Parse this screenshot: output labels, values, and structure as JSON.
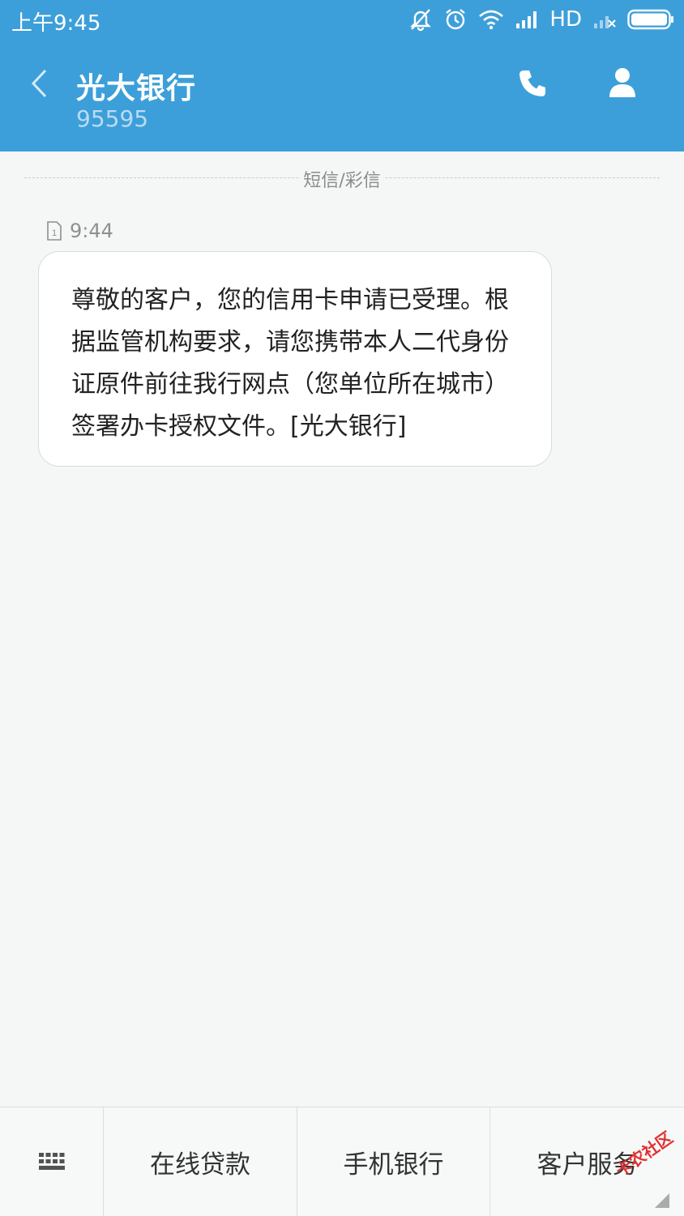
{
  "status_bar": {
    "time": "上午9:45",
    "network": "HD"
  },
  "header": {
    "title": "光大银行",
    "subtitle": "95595"
  },
  "divider_label": "短信/彩信",
  "message": {
    "time": "9:44",
    "body": "尊敬的客户，您的信用卡申请已受理。根据监管机构要求，请您携带本人二代身份证原件前往我行网点（您单位所在城市）签署办卡授权文件。[光大银行]"
  },
  "bottom_menu": [
    "在线贷款",
    "手机银行",
    "客户服务"
  ],
  "watermark": "卡农社区",
  "colors": {
    "header": "#3d9fd9",
    "background": "#f5f6f6",
    "bubble": "#ffffff"
  }
}
